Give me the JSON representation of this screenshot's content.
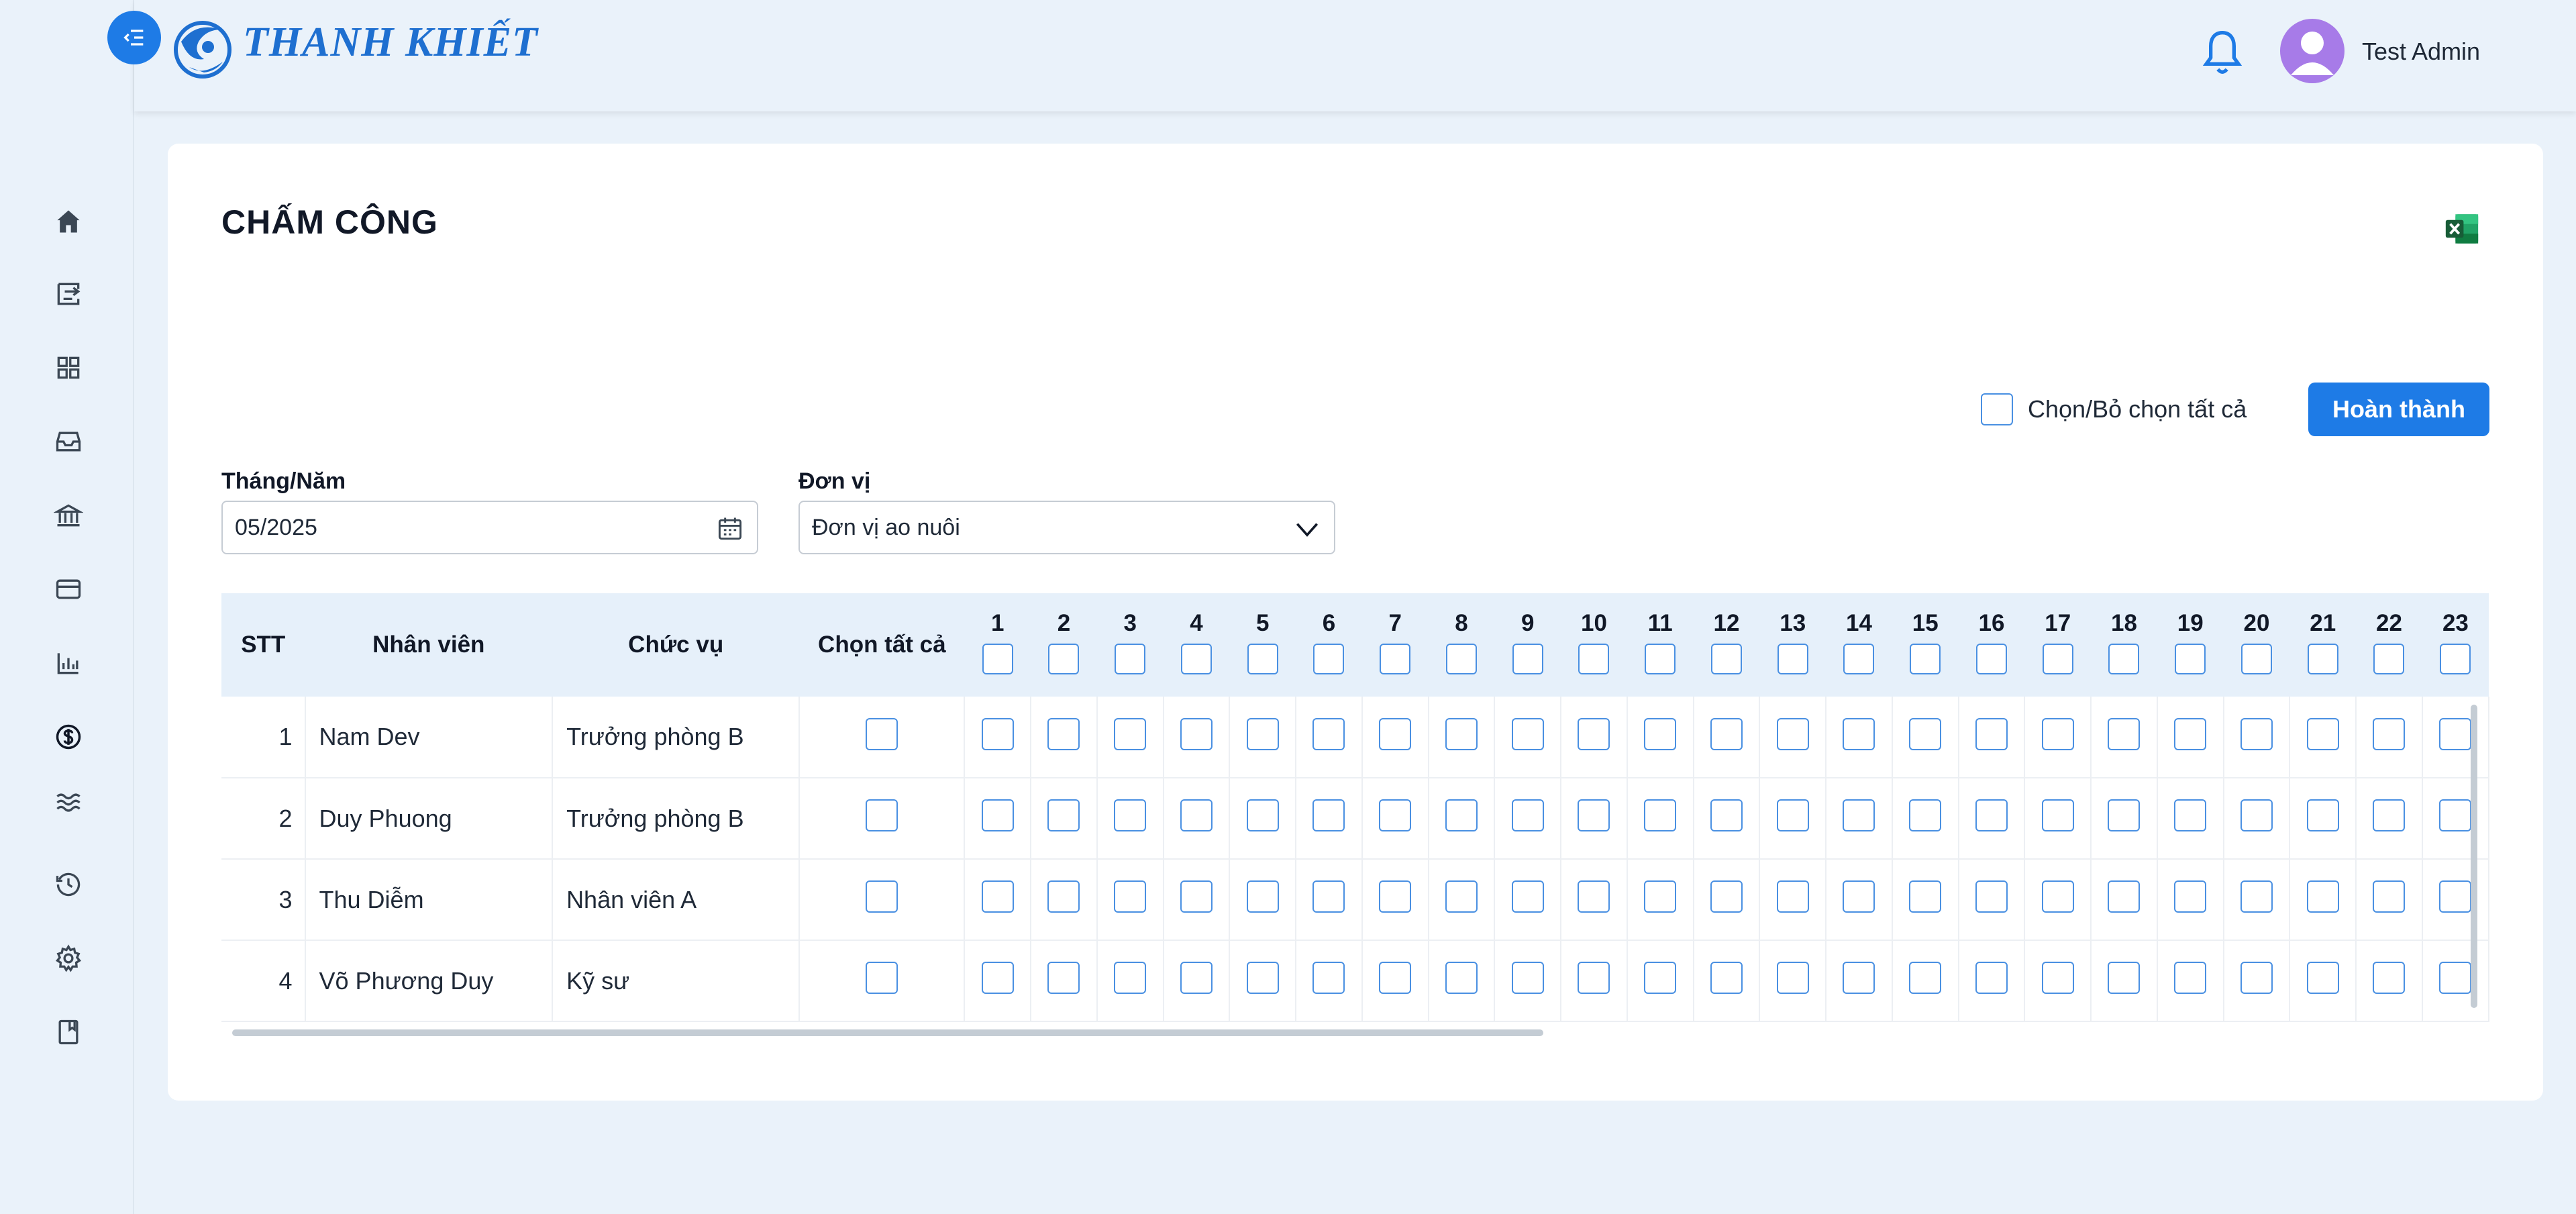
{
  "brand": {
    "name": "THANH KHIẾT"
  },
  "header": {
    "user_name": "Test Admin"
  },
  "sidebar": {
    "items": [
      {
        "icon": "home-icon"
      },
      {
        "icon": "transfer-icon"
      },
      {
        "icon": "grid-icon"
      },
      {
        "icon": "inbox-icon"
      },
      {
        "icon": "bank-icon"
      },
      {
        "icon": "card-icon"
      },
      {
        "icon": "chart-icon"
      },
      {
        "icon": "dollar-icon"
      },
      {
        "icon": "waves-icon"
      },
      {
        "icon": "history-icon"
      },
      {
        "icon": "gear-icon"
      },
      {
        "icon": "book-icon"
      }
    ]
  },
  "page": {
    "title": "CHẤM CÔNG",
    "select_all_label": "Chọn/Bỏ chọn tất cả",
    "done_label": "Hoàn thành"
  },
  "filters": {
    "month_label": "Tháng/Năm",
    "month_value": "05/2025",
    "unit_label": "Đơn vị",
    "unit_value": "Đơn vị ao nuôi"
  },
  "table": {
    "headers": {
      "stt": "STT",
      "employee": "Nhân viên",
      "role": "Chức vụ",
      "select_all": "Chọn tất cả"
    },
    "days": [
      "1",
      "2",
      "3",
      "4",
      "5",
      "6",
      "7",
      "8",
      "9",
      "10",
      "11",
      "12",
      "13",
      "14",
      "15",
      "16",
      "17",
      "18",
      "19",
      "20",
      "21",
      "22",
      "23"
    ],
    "rows": [
      {
        "stt": "1",
        "name": "Nam Dev",
        "role": "Trưởng phòng B"
      },
      {
        "stt": "2",
        "name": "Duy Phuong",
        "role": "Trưởng phòng B"
      },
      {
        "stt": "3",
        "name": "Thu Diễm",
        "role": "Nhân viên A"
      },
      {
        "stt": "4",
        "name": "Võ Phương Duy",
        "role": "Kỹ sư"
      }
    ]
  },
  "colors": {
    "accent": "#1e7be6",
    "checkbox_border": "#4a90e2",
    "header_bg": "#e6f0fa",
    "page_bg": "#eaf2fa"
  }
}
